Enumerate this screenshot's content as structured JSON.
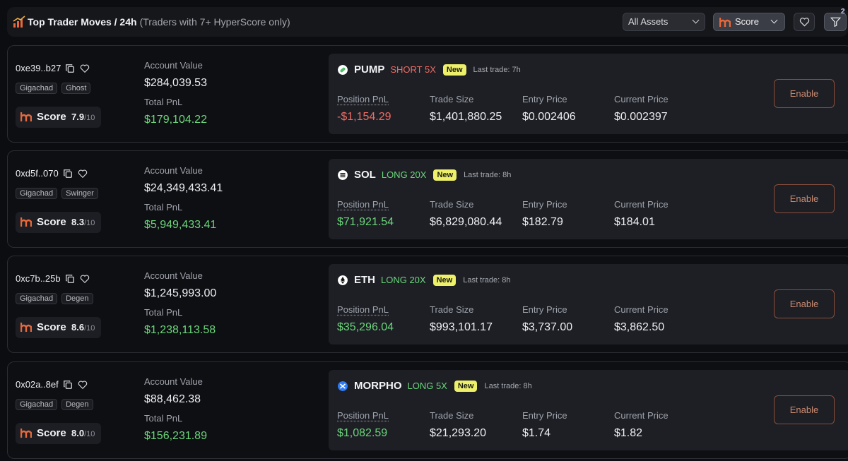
{
  "header": {
    "title": "Top Trader Moves / 24h",
    "subtitle": "(Traders with 7+ HyperScore only)",
    "assets_filter": "All Assets",
    "sort_filter": "Score",
    "filter_badge": "2"
  },
  "colors": {
    "positive": "#6bd67a",
    "negative": "#f16b63",
    "accent": "#e8683a",
    "new_badge": "#eef06a"
  },
  "labels": {
    "account_value": "Account Value",
    "total_pnl": "Total PnL",
    "position_pnl": "Position PnL",
    "trade_size": "Trade Size",
    "entry_price": "Entry Price",
    "current_price": "Current Price",
    "score": "Score",
    "score_denom": "/10",
    "new": "New",
    "enable": "Enable"
  },
  "traders": [
    {
      "address": "0xe39..b27",
      "tags": [
        "Gigachad",
        "Ghost"
      ],
      "score": "7.9",
      "account_value": "$284,039.53",
      "total_pnl": "$179,104.22",
      "trade": {
        "coin": "PUMP",
        "coin_icon": "pump-icon",
        "direction": "SHORT 5X",
        "side": "short",
        "last_trade": "Last trade: 7h",
        "position_pnl": "-$1,154.29",
        "pnl_sign": "negative",
        "trade_size": "$1,401,880.25",
        "entry_price": "$0.002406",
        "current_price": "$0.002397"
      }
    },
    {
      "address": "0xd5f..070",
      "tags": [
        "Gigachad",
        "Swinger"
      ],
      "score": "8.3",
      "account_value": "$24,349,433.41",
      "total_pnl": "$5,949,433.41",
      "trade": {
        "coin": "SOL",
        "coin_icon": "sol-icon",
        "direction": "LONG 20X",
        "side": "long",
        "last_trade": "Last trade: 8h",
        "position_pnl": "$71,921.54",
        "pnl_sign": "positive",
        "trade_size": "$6,829,080.44",
        "entry_price": "$182.79",
        "current_price": "$184.01"
      }
    },
    {
      "address": "0xc7b..25b",
      "tags": [
        "Gigachad",
        "Degen"
      ],
      "score": "8.6",
      "account_value": "$1,245,993.00",
      "total_pnl": "$1,238,113.58",
      "trade": {
        "coin": "ETH",
        "coin_icon": "eth-icon",
        "direction": "LONG 20X",
        "side": "long",
        "last_trade": "Last trade: 8h",
        "position_pnl": "$35,296.04",
        "pnl_sign": "positive",
        "trade_size": "$993,101.17",
        "entry_price": "$3,737.00",
        "current_price": "$3,862.50"
      }
    },
    {
      "address": "0x02a..8ef",
      "tags": [
        "Gigachad",
        "Degen"
      ],
      "score": "8.0",
      "account_value": "$88,462.38",
      "total_pnl": "$156,231.89",
      "trade": {
        "coin": "MORPHO",
        "coin_icon": "morpho-icon",
        "direction": "LONG 5X",
        "side": "long",
        "last_trade": "Last trade: 8h",
        "position_pnl": "$1,082.59",
        "pnl_sign": "positive",
        "trade_size": "$21,293.20",
        "entry_price": "$1.74",
        "current_price": "$1.82"
      }
    }
  ]
}
